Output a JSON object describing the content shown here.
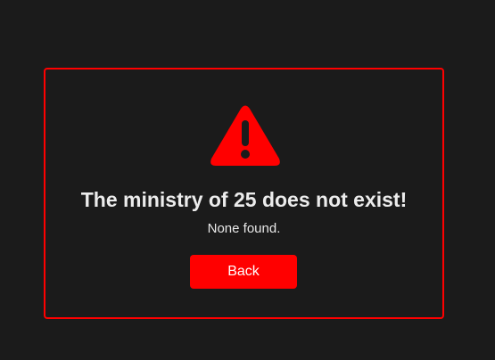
{
  "error": {
    "icon": "warning-triangle-icon",
    "title": "The ministry of 25 does not exist!",
    "message": "None found.",
    "back_label": "Back"
  },
  "colors": {
    "background": "#1b1b1b",
    "accent": "#ff0000",
    "text": "#ececec"
  }
}
